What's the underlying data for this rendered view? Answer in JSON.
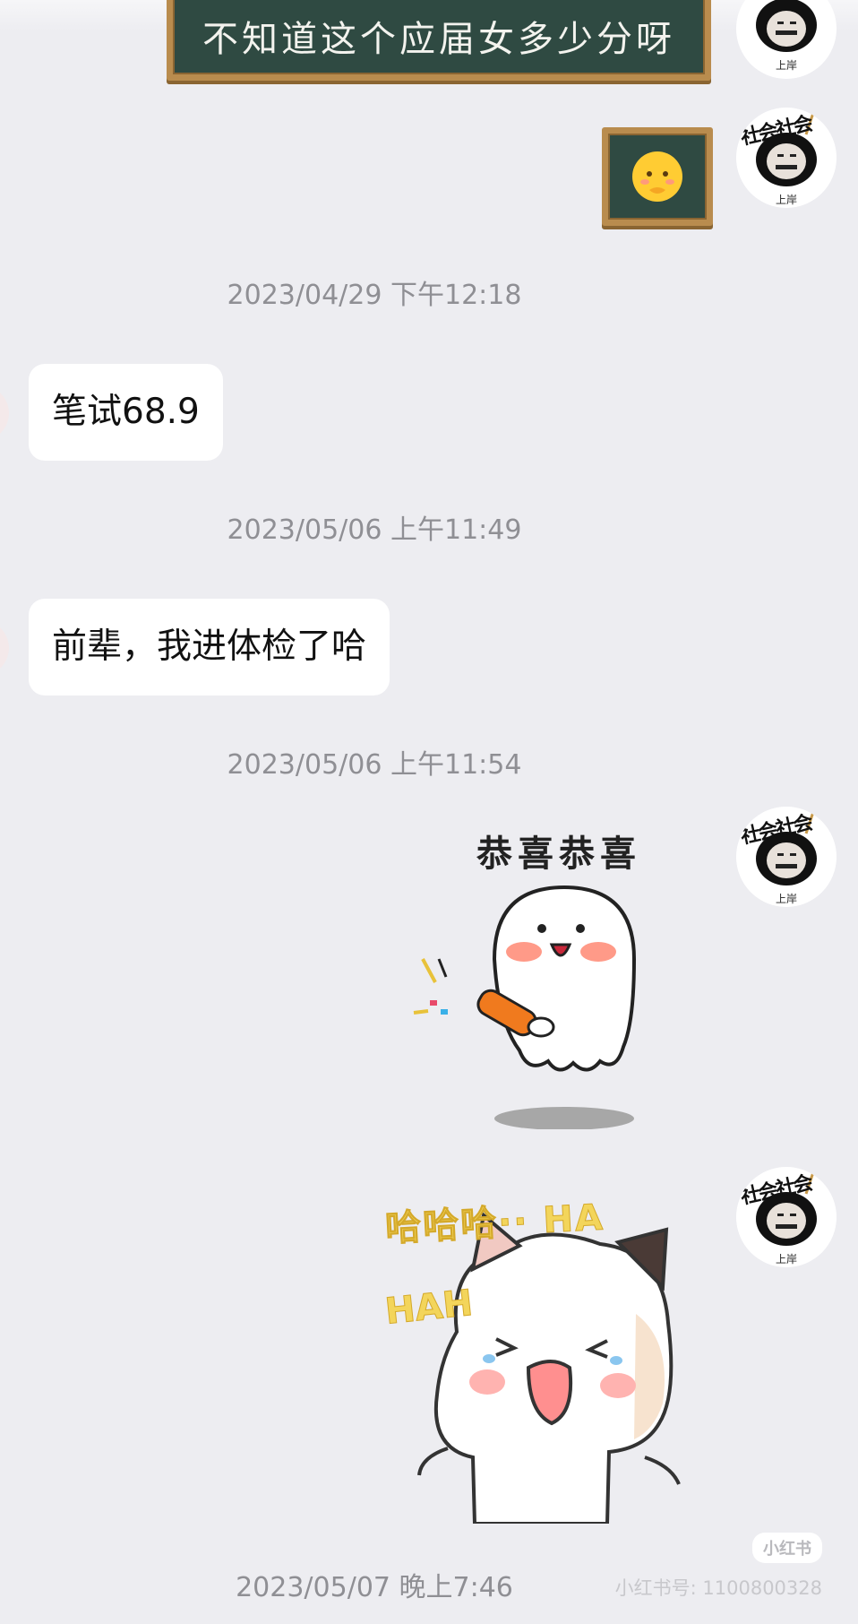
{
  "messages": {
    "chalkboard_text": "不知道这个应届女多少分呀",
    "timestamps": [
      "2023/04/29 下午12:18",
      "2023/05/06 上午11:49",
      "2023/05/06 上午11:54",
      "2023/05/07 晚上7:46"
    ],
    "bubble_1": "笔试68.9",
    "bubble_2": "前辈，我进体检了哈",
    "sticker_congrats_caption": "恭喜恭喜",
    "sticker_laugh_caption_1": "哈哈哈·· HA",
    "sticker_laugh_caption_2": "HAH"
  },
  "avatar": {
    "badge_text": "上岸",
    "hat_text": "社会社会"
  },
  "watermark": {
    "logo": "小红书",
    "id": "小红书号: 1100800328"
  },
  "colors": {
    "background": "#ededf1",
    "bubble": "#ffffff",
    "timestamp": "#8f8f94",
    "chalkboard": "#2f4a42",
    "chalkboard_frame": "#b98c4e"
  }
}
